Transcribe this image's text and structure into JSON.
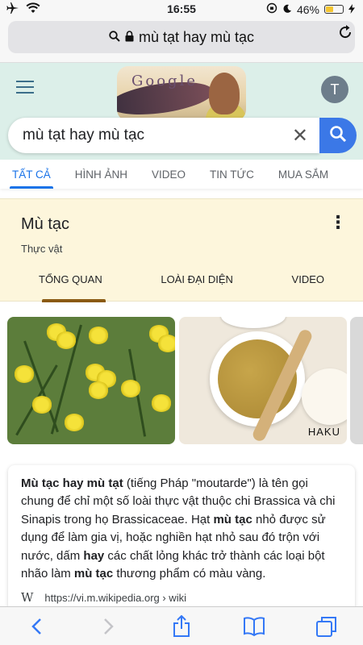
{
  "status": {
    "time": "16:55",
    "battery": "46%",
    "battery_level": 0.46
  },
  "browser": {
    "url_text": "mù tạt hay mù tạc"
  },
  "google": {
    "avatar_letter": "T",
    "doodle_text": "Google",
    "query": "mù tạt hay mù tạc",
    "tabs": [
      "TẤT CẢ",
      "HÌNH ẢNH",
      "VIDEO",
      "TIN TỨC",
      "MUA SẮM"
    ]
  },
  "knowledge": {
    "title": "Mù tạc",
    "subtitle": "Thực vật",
    "tabs": [
      "TỔNG QUAN",
      "LOÀI ĐẠI DIỆN",
      "VIDEO"
    ]
  },
  "images": {
    "watermark": "HAKU"
  },
  "snippet": {
    "parts": [
      {
        "t": "Mù tạc hay mù tạt",
        "b": true
      },
      {
        "t": " (tiếng Pháp \"moutarde\") là tên gọi chung để chỉ một số loài thực vật thuộc chi Brassica và chi Sinapis trong họ Brassicaceae. Hạt ",
        "b": false
      },
      {
        "t": "mù tạc",
        "b": true
      },
      {
        "t": " nhỏ được sử dụng để làm gia vị, hoặc nghiền hạt nhỏ sau đó trộn với nước, dấm ",
        "b": false
      },
      {
        "t": "hay",
        "b": true
      },
      {
        "t": " các chất lỏng khác trở thành các loại bột nhão làm ",
        "b": false
      },
      {
        "t": "mù tạc",
        "b": true
      },
      {
        "t": " thương phẩm có màu vàng.",
        "b": false
      }
    ],
    "source_icon": "W",
    "source_url": "https://vi.m.wikipedia.org › wiki"
  },
  "colors": {
    "accent": "#1a73e8",
    "search_button": "#3b78e7",
    "card_bg": "#fdf6dc",
    "card_tab_indicator": "#8b5a13"
  }
}
